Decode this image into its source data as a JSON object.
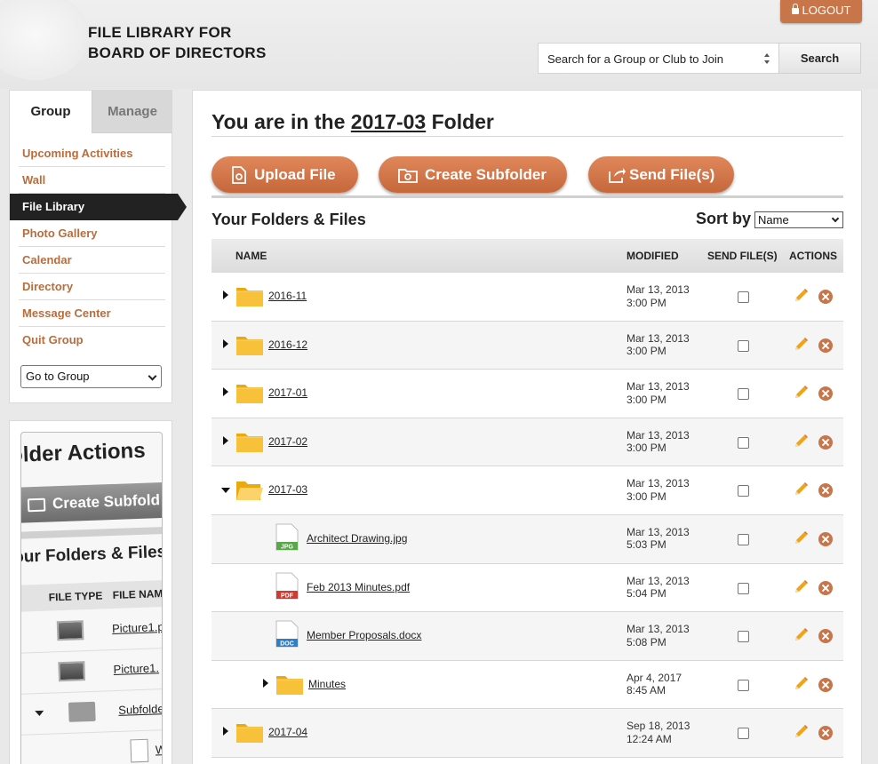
{
  "header": {
    "title_line1": "FILE LIBRARY FOR",
    "title_line2": "BOARD OF DIRECTORS",
    "logout_label": "LOGOUT",
    "search_value": "Search for a Group or Club to Join",
    "search_button": "Search"
  },
  "nav": {
    "tabs": [
      "Group",
      "Manage"
    ],
    "items": [
      "Upcoming Activities",
      "Wall",
      "File Library",
      "Photo Gallery",
      "Calendar",
      "Directory",
      "Message Center",
      "Quit Group"
    ],
    "active_item": "File Library",
    "goto_select": "Go to Group"
  },
  "help_image": {
    "title": "older Actions",
    "button": "Create Subfold",
    "subtitle": "our Folders & Files",
    "col_type": "FILE TYPE",
    "col_name": "FILE NAME",
    "rows": [
      "Picture1.p",
      "Picture1.",
      "Subfolde",
      "W"
    ]
  },
  "main": {
    "heading_prefix": "You are in the ",
    "heading_folder": "2017-03",
    "heading_suffix": " Folder",
    "buttons": {
      "upload": "Upload File",
      "subfolder": "Create Subfolder",
      "send": "Send File(s)"
    },
    "list_title": "Your Folders & Files",
    "sort_label": "Sort by",
    "sort_value": "Name",
    "columns": {
      "name": "NAME",
      "modified": "MODIFIED",
      "send": "SEND FILE(S)",
      "actions": "ACTIONS"
    },
    "rows": [
      {
        "type": "folder",
        "name": "2016-11",
        "date": "Mar 13, 2013",
        "time": "3:00 PM",
        "expanded": false,
        "indent": 0
      },
      {
        "type": "folder",
        "name": "2016-12",
        "date": "Mar 13, 2013",
        "time": "3:00 PM",
        "expanded": false,
        "indent": 0
      },
      {
        "type": "folder",
        "name": "2017-01",
        "date": "Mar 13, 2013",
        "time": "3:00 PM",
        "expanded": false,
        "indent": 0
      },
      {
        "type": "folder",
        "name": "2017-02",
        "date": "Mar 13, 2013",
        "time": "3:00 PM",
        "expanded": false,
        "indent": 0
      },
      {
        "type": "folder",
        "name": "2017-03",
        "date": "Mar 13, 2013",
        "time": "3:00 PM",
        "expanded": true,
        "indent": 0
      },
      {
        "type": "jpg",
        "name": "Architect Drawing.jpg",
        "date": "Mar 13, 2013",
        "time": "5:03 PM",
        "badge": "JPG",
        "indent": 1
      },
      {
        "type": "pdf",
        "name": "Feb 2013 Minutes.pdf",
        "date": "Mar 13, 2013",
        "time": "5:04 PM",
        "badge": "PDF",
        "indent": 1
      },
      {
        "type": "doc",
        "name": "Member Proposals.docx",
        "date": "Mar 13, 2013",
        "time": "5:08 PM",
        "badge": "DOC",
        "indent": 1
      },
      {
        "type": "folder",
        "name": "Minutes",
        "date": "Apr 4, 2017",
        "time": "8:45 AM",
        "expanded": false,
        "indent": 1
      },
      {
        "type": "folder",
        "name": "2017-04",
        "date": "Sep 18, 2013",
        "time": "12:24 AM",
        "expanded": false,
        "indent": 0
      }
    ]
  },
  "colors": {
    "accent": "#c8754a",
    "nav_link": "#b86d3f",
    "folder": "#f5b820",
    "active_nav": "#222222"
  }
}
